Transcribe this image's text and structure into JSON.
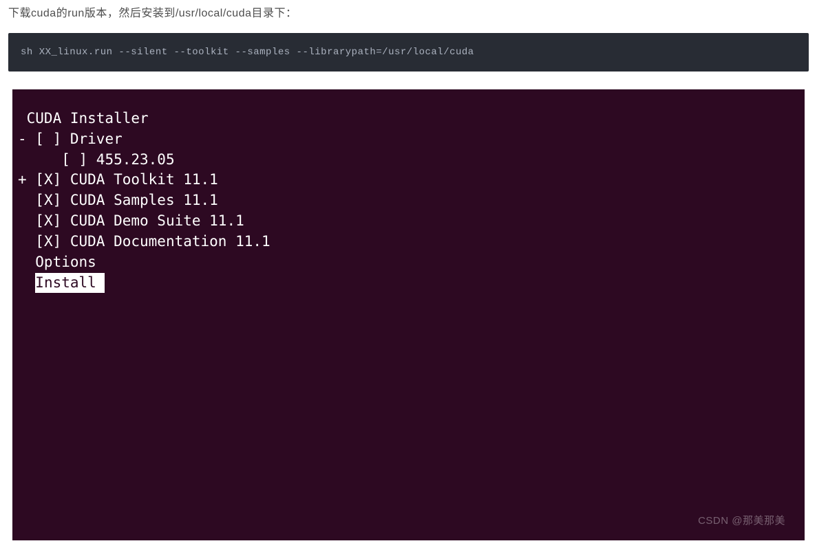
{
  "intro": "下载cuda的run版本，然后安装到/usr/local/cuda目录下：",
  "command": "sh XX_linux.run --silent --toolkit --samples --librarypath=/usr/local/cuda",
  "installer": {
    "title": " CUDA Installer",
    "items": [
      {
        "prefix": "- ",
        "check": "[ ]",
        "label": " Driver"
      },
      {
        "prefix": "     ",
        "check": "[ ]",
        "label": " 455.23.05"
      },
      {
        "prefix": "+ ",
        "check": "[X]",
        "label": " CUDA Toolkit 11.1"
      },
      {
        "prefix": "  ",
        "check": "[X]",
        "label": " CUDA Samples 11.1"
      },
      {
        "prefix": "  ",
        "check": "[X]",
        "label": " CUDA Demo Suite 11.1"
      },
      {
        "prefix": "  ",
        "check": "[X]",
        "label": " CUDA Documentation 11.1"
      }
    ],
    "options_label": "  Options",
    "install_prefix": "  ",
    "install_label": "Install "
  },
  "watermark": "CSDN @那美那美"
}
